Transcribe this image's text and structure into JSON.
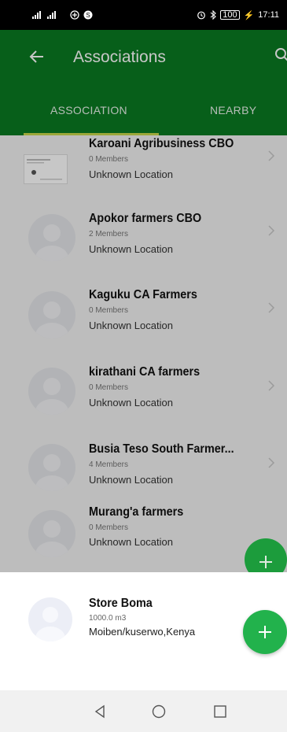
{
  "status_bar": {
    "left_signal": "⁴ᴳ⸮⁴ᴳ⸮",
    "battery": "100",
    "time": "17:11"
  },
  "app_bar": {
    "title": "Associations",
    "back_icon": "arrow-left-icon",
    "search_icon": "search-icon"
  },
  "tabs": [
    {
      "label": "ASSOCIATION",
      "active": true
    },
    {
      "label": "NEARBY",
      "active": false
    }
  ],
  "associations": [
    {
      "name": "Karoani Agribusiness CBO",
      "members": "0 Members",
      "location": "Unknown Location",
      "avatar": "logo"
    },
    {
      "name": "Apokor farmers CBO",
      "members": "2 Members",
      "location": "Unknown Location",
      "avatar": "person"
    },
    {
      "name": "Kaguku CA Farmers",
      "members": "0 Members",
      "location": "Unknown Location",
      "avatar": "person"
    },
    {
      "name": "kirathani CA farmers",
      "members": "0 Members",
      "location": "Unknown Location",
      "avatar": "person"
    },
    {
      "name": "Busia Teso South Farmer...",
      "members": "4 Members",
      "location": "Unknown Location",
      "avatar": "person"
    },
    {
      "name": "Murang'a farmers",
      "members": "0 Members",
      "location": "Unknown Location",
      "avatar": "person"
    }
  ],
  "bottom_sheet": {
    "name": "Store Boma",
    "volume": "1000.0 m3",
    "location": "Moiben/kuserwo,Kenya"
  },
  "colors": {
    "primary": "#0a7a22",
    "accent": "#22b24c",
    "tab_indicator": "#c8d84a"
  }
}
